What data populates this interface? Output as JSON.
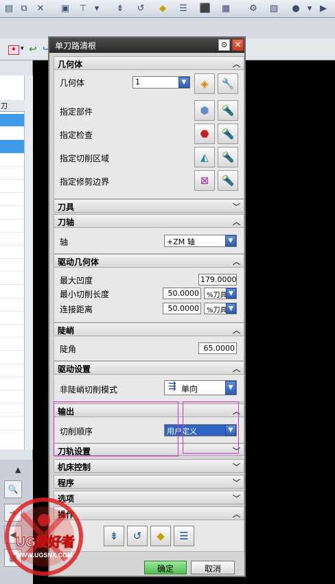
{
  "toolbar": {
    "icons": [
      "move-icon",
      "copy-icon",
      "delete-icon",
      "paste-icon",
      "filter-icon",
      "dropdown-icon",
      "generate-path-icon",
      "replay-path-icon",
      "verify-path-icon",
      "list-path-icon",
      "ship-icon",
      "postprocess-icon",
      "tool-config-icon",
      "output-icon",
      "dropdown2-icon",
      "play-icon"
    ]
  },
  "left_panel": {
    "column_header": "刀"
  },
  "dialog": {
    "title": "单刀路清根",
    "sections": {
      "geometry": {
        "title": "几何体",
        "geometry_label": "几何体",
        "geometry_value": "1",
        "specify_part": "指定部件",
        "specify_check": "指定检查",
        "specify_cut_area": "指定切削区域",
        "specify_trim_boundary": "指定修剪边界"
      },
      "tool": {
        "title": "刀具"
      },
      "tool_axis": {
        "title": "刀轴",
        "axis_label": "轴",
        "axis_value": "+ZM 轴"
      },
      "drive_geometry": {
        "title": "驱动几何体",
        "max_concavity_label": "最大凹度",
        "max_concavity_value": "179.0000",
        "min_cut_length_label": "最小切削长度",
        "min_cut_length_value": "50.0000",
        "min_cut_length_unit": "%刀具",
        "connect_distance_label": "连接距离",
        "connect_distance_value": "50.0000",
        "connect_distance_unit": "%刀具"
      },
      "steep": {
        "title": "陡峭",
        "steep_angle_label": "陡角",
        "steep_angle_value": "65.0000"
      },
      "drive_settings": {
        "title": "驱动设置",
        "non_steep_mode_label": "非陡峭切削模式",
        "non_steep_mode_value": "单向"
      },
      "output": {
        "title": "输出",
        "cut_order_label": "切削顺序",
        "cut_order_value": "用户定义"
      },
      "path_settings": {
        "title": "刀轨设置"
      },
      "machine_control": {
        "title": "机床控制"
      },
      "program": {
        "title": "程序"
      },
      "options": {
        "title": "选项"
      },
      "actions": {
        "title": "操作"
      }
    },
    "ok_label": "确定",
    "cancel_label": "取消"
  },
  "watermark": {
    "brand": "UG爱好者",
    "url": "WWW.UGSNX.COM"
  }
}
